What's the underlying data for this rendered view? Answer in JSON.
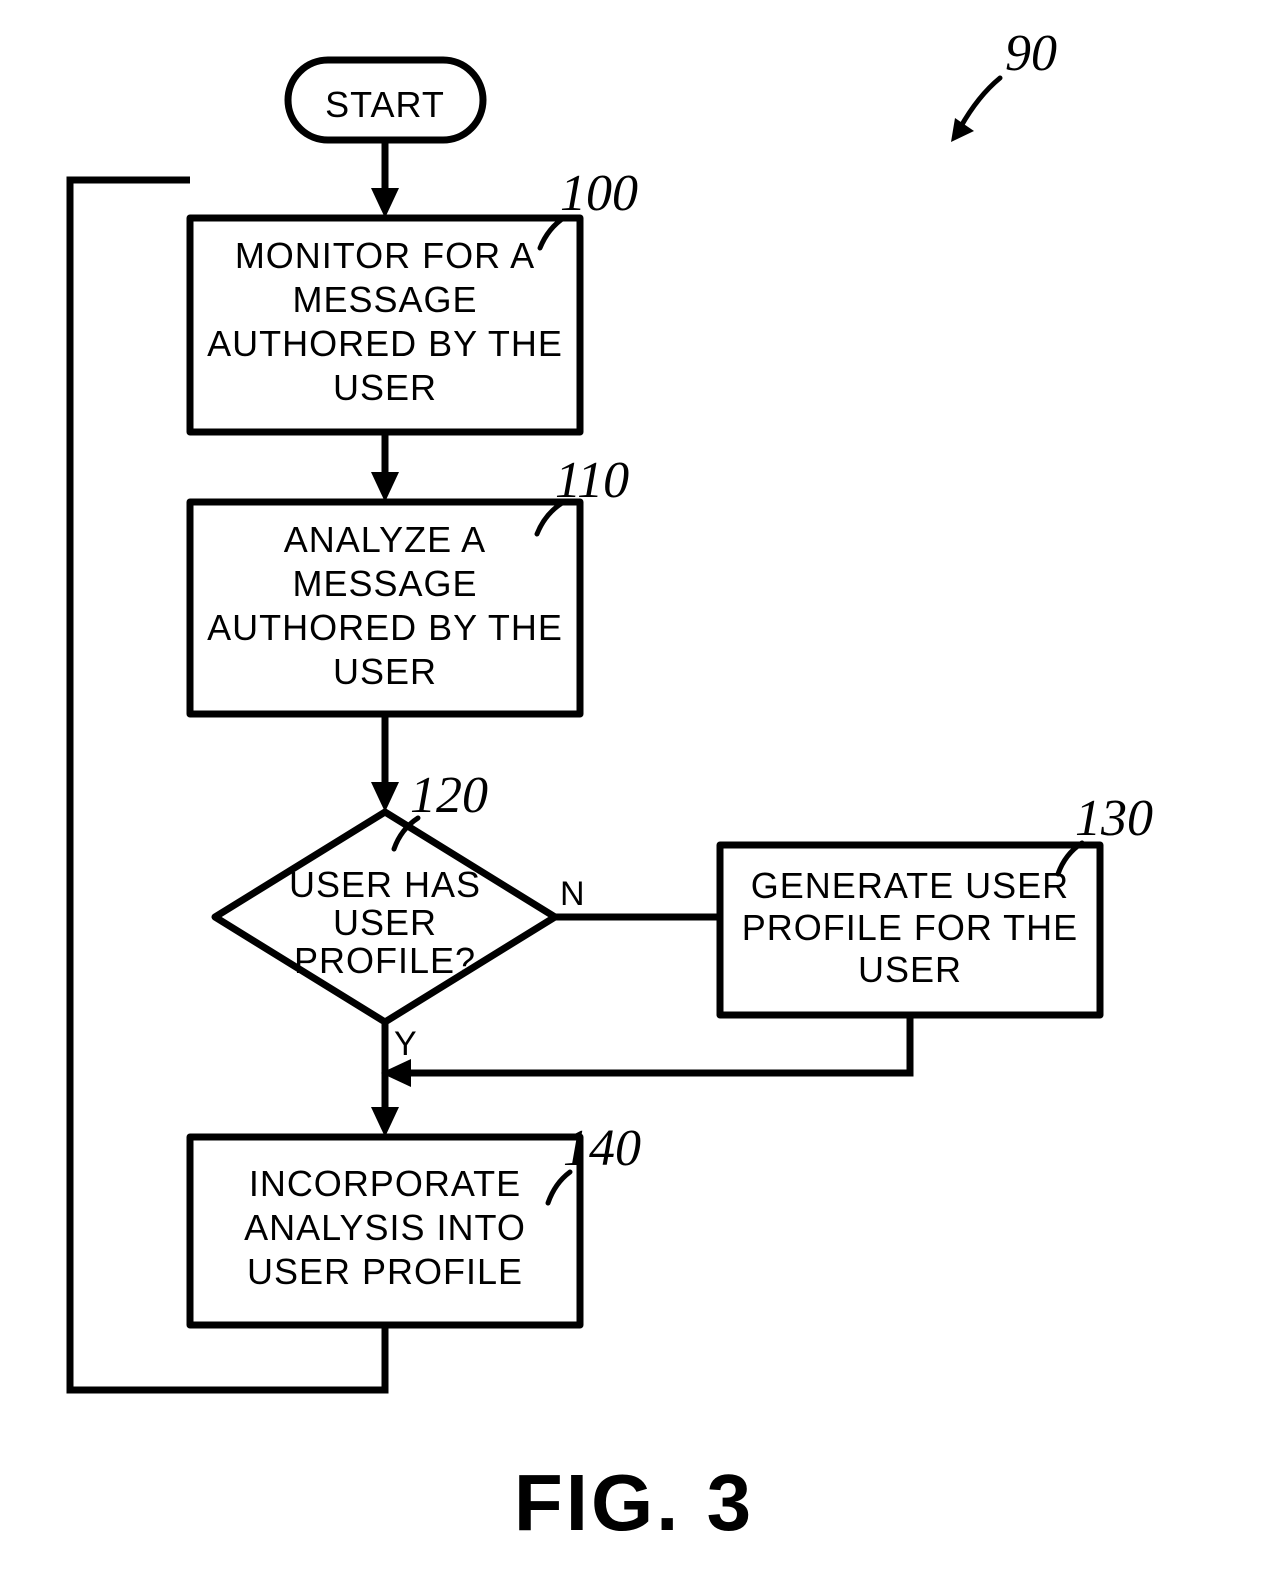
{
  "figure": {
    "ref": "90",
    "title": "FIG. 3"
  },
  "nodes": {
    "start": {
      "label": "START"
    },
    "n100": {
      "label1": "MONITOR FOR A",
      "label2": "MESSAGE",
      "label3": "AUTHORED BY THE",
      "label4": "USER",
      "ref": "100"
    },
    "n110": {
      "label1": "ANALYZE A",
      "label2": "MESSAGE",
      "label3": "AUTHORED BY THE",
      "label4": "USER",
      "ref": "110"
    },
    "n120": {
      "label1": "USER HAS",
      "label2": "USER",
      "label3": "PROFILE?",
      "ref": "120",
      "no": "N",
      "yes": "Y"
    },
    "n130": {
      "label1": "GENERATE USER",
      "label2": "PROFILE FOR THE",
      "label3": "USER",
      "ref": "130"
    },
    "n140": {
      "label1": "INCORPORATE",
      "label2": "ANALYSIS INTO",
      "label3": "USER PROFILE",
      "ref": "140"
    }
  }
}
